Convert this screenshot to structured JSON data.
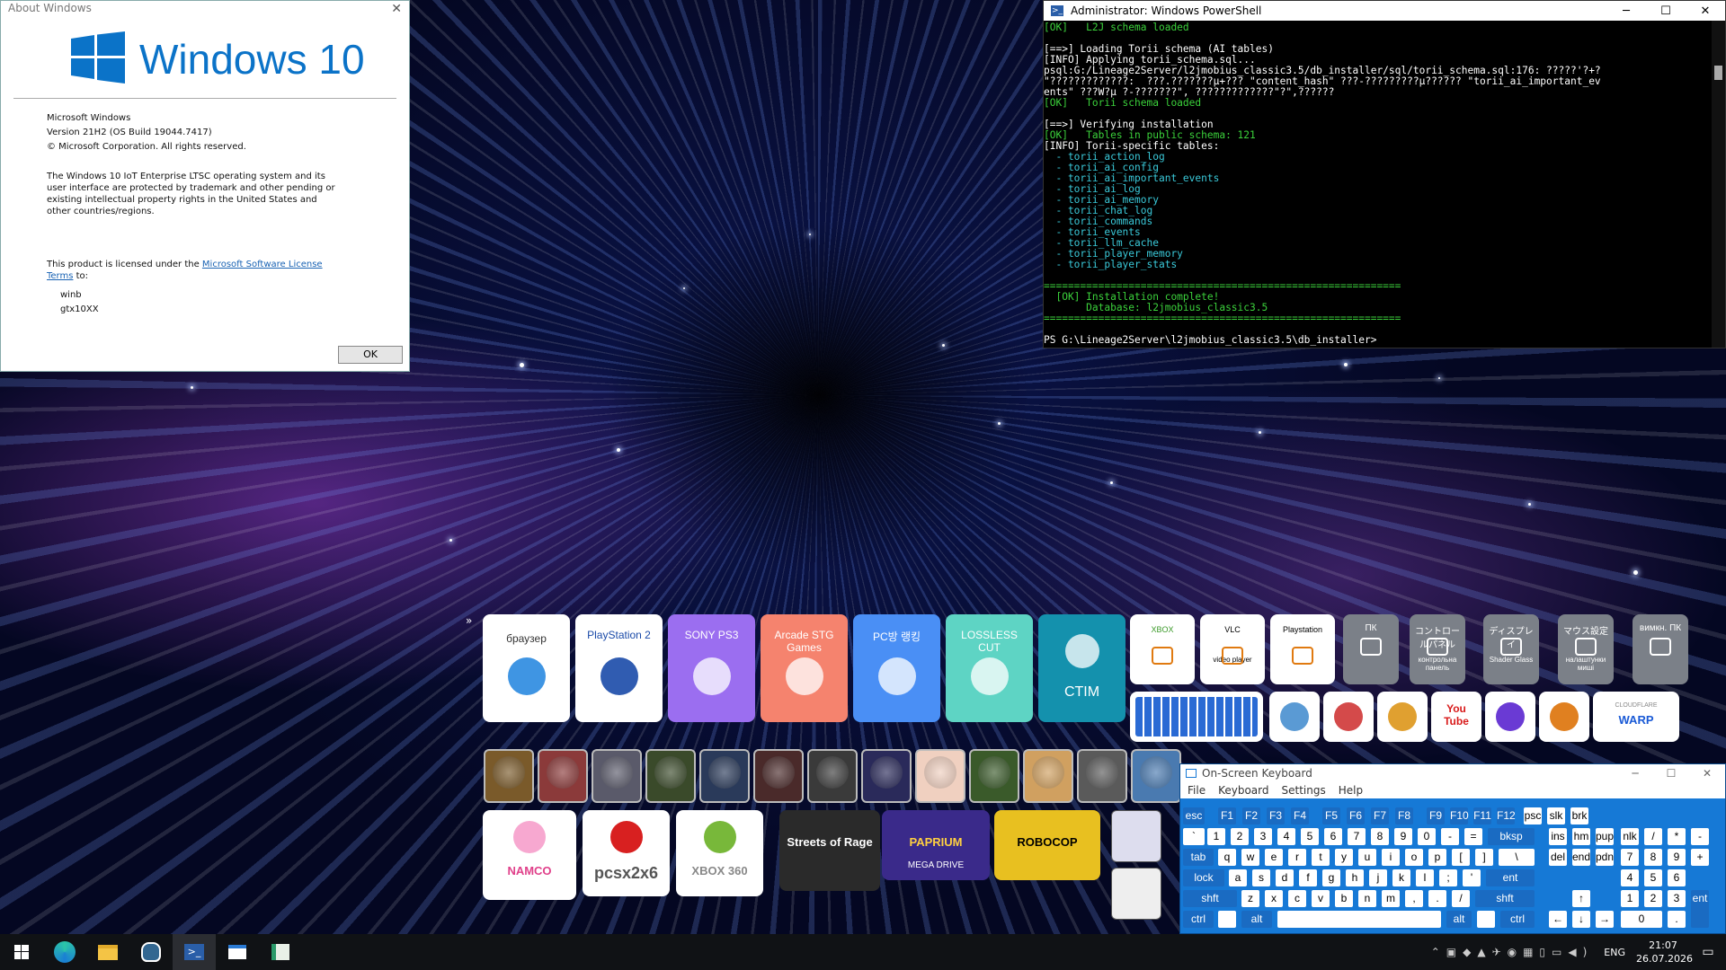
{
  "about": {
    "title": "About Windows",
    "logo_text": "Windows 10",
    "product": "Microsoft Windows",
    "version": "Version 21H2 (OS Build 19044.7417)",
    "copyright": "© Microsoft Corporation. All rights reserved.",
    "description": "The Windows 10 IoT Enterprise LTSC operating system and its user interface are protected by trademark and other pending or existing intellectual property rights in the United States and other countries/regions.",
    "license_prefix": "This product is licensed under the",
    "license_link": "Microsoft Software License Terms",
    "license_suffix": "to:",
    "user": "winb",
    "org": "gtx10XX",
    "ok_label": "OK"
  },
  "powershell": {
    "title": "Administrator: Windows PowerShell",
    "lines": [
      {
        "t": "[OK]   L2J schema loaded",
        "c": "g"
      },
      {
        "t": "",
        "c": "w"
      },
      {
        "t": "[==>] Loading Torii schema (AI tables)",
        "c": "w"
      },
      {
        "t": "[INFO] Applying torii_schema.sql...",
        "c": "w"
      },
      {
        "t": "psql:G:/Lineage2Server/l2jmobius_classic3.5/db_installer/sql/torii_schema.sql:176: ?????'?+?",
        "c": "w"
      },
      {
        "t": "\"?????????????:  ???.???????µ+??? \"content_hash\" ???-?????????µ?????? \"torii_ai_important_ev",
        "c": "w"
      },
      {
        "t": "ents\" ???W?µ ?-???????\", ?????????????\"?\",??????",
        "c": "w"
      },
      {
        "t": "[OK]   Torii schema loaded",
        "c": "g"
      },
      {
        "t": "",
        "c": "w"
      },
      {
        "t": "[==>] Verifying installation",
        "c": "w"
      },
      {
        "t": "[OK]   Tables in public schema: 121",
        "c": "g"
      },
      {
        "t": "[INFO] Torii-specific tables:",
        "c": "w"
      },
      {
        "t": "  - torii_action_log",
        "c": "c"
      },
      {
        "t": "  - torii_ai_config",
        "c": "c"
      },
      {
        "t": "  - torii_ai_important_events",
        "c": "c"
      },
      {
        "t": "  - torii_ai_log",
        "c": "c"
      },
      {
        "t": "  - torii_ai_memory",
        "c": "c"
      },
      {
        "t": "  - torii_chat_log",
        "c": "c"
      },
      {
        "t": "  - torii_commands",
        "c": "c"
      },
      {
        "t": "  - torii_events",
        "c": "c"
      },
      {
        "t": "  - torii_llm_cache",
        "c": "c"
      },
      {
        "t": "  - torii_player_memory",
        "c": "c"
      },
      {
        "t": "  - torii_player_stats",
        "c": "c"
      },
      {
        "t": "",
        "c": "w"
      },
      {
        "t": "===========================================================",
        "c": "g"
      },
      {
        "t": "  [OK] Installation complete!",
        "c": "g"
      },
      {
        "t": "       Database: l2jmobius_classic3.5",
        "c": "g"
      },
      {
        "t": "===========================================================",
        "c": "g"
      },
      {
        "t": "",
        "c": "w"
      },
      {
        "t": "PS G:\\Lineage2Server\\l2jmobius_classic3.5\\db_installer>",
        "c": "w"
      }
    ]
  },
  "tiles_large": [
    {
      "id": "browser",
      "label": "браузер",
      "bg": "#ffffff",
      "fg": "#333"
    },
    {
      "id": "ps2",
      "label": "PlayStation 2",
      "bg": "#ffffff",
      "fg": "#1a4aa8"
    },
    {
      "id": "ps3",
      "label": "SONY PS3",
      "bg": "#9b6ef0",
      "fg": "#fff"
    },
    {
      "id": "mame",
      "label": "Arcade STG Games",
      "bg": "#f5836e",
      "fg": "#fff"
    },
    {
      "id": "opgg",
      "label": "PC방 랭킹",
      "bg": "#4a8ff5",
      "fg": "#fff"
    },
    {
      "id": "lossless",
      "label": "LOSSLESS CUT",
      "bg": "#5ed4c4",
      "fg": "#fff"
    },
    {
      "id": "steam",
      "label": "CTIM",
      "bg": "#1491ad",
      "fg": "#fff"
    }
  ],
  "tiles_small_top": [
    {
      "id": "xbox",
      "label": "XBOX",
      "bg": "#ffffff",
      "fg": "#3c9a2a"
    },
    {
      "id": "vlc",
      "label": "VLC",
      "sub": "video player",
      "bg": "#ffffff",
      "fg": "#000"
    },
    {
      "id": "playstation",
      "label": "Playstation",
      "bg": "#ffffff",
      "fg": "#000"
    },
    {
      "id": "pc",
      "label": "ПК",
      "bg": "#7b8088",
      "fg": "#fff"
    },
    {
      "id": "control",
      "label": "コントロールパネル",
      "sub": "контрольна панель",
      "bg": "#7b8088",
      "fg": "#fff"
    },
    {
      "id": "display",
      "label": "ディスプレイ",
      "sub": "Shader Glass",
      "bg": "#7b8088",
      "fg": "#fff"
    },
    {
      "id": "mouse",
      "label": "マウス設定",
      "sub": "налаштунки миші",
      "bg": "#7b8088",
      "fg": "#fff"
    },
    {
      "id": "power",
      "label": "вимкн. ПК",
      "bg": "#7b8088",
      "fg": "#fff"
    }
  ],
  "tiles_row2": [
    {
      "id": "osk",
      "bg": "#ffffff"
    },
    {
      "id": "emu",
      "bg": "#ffffff"
    },
    {
      "id": "orbit",
      "bg": "#ffffff"
    },
    {
      "id": "cocktail",
      "bg": "#ffffff"
    },
    {
      "id": "youtube",
      "label": "You Tube",
      "bg": "#ffffff"
    },
    {
      "id": "tor",
      "bg": "#ffffff"
    },
    {
      "id": "bolt",
      "bg": "#ffffff"
    },
    {
      "id": "warp",
      "label": "WARP",
      "sub": "CLOUDFLARE",
      "bg": "#ffffff"
    }
  ],
  "game_row_colors": [
    "#7a5a2a",
    "#8b3a3a",
    "#5a5a6a",
    "#3a4a2a",
    "#2a3a5a",
    "#4a2a2a",
    "#3a3a3a",
    "#2a2a5a",
    "#f0d0c0",
    "#3a5a2a",
    "#d0a060",
    "#5a5a5a",
    "#4a7ab0"
  ],
  "tiles_bottom": [
    {
      "id": "namco",
      "label": "NAMCO",
      "bg": "#ffffff",
      "fg": "#e0408a"
    },
    {
      "id": "pcsx2",
      "label": "pcsx2x6",
      "bg": "#ffffff",
      "fg": "#555"
    },
    {
      "id": "xbox360",
      "label": "XBOX 360",
      "bg": "#ffffff",
      "fg": "#888"
    },
    {
      "id": "streets",
      "label": "Streets of Rage",
      "bg": "#2a2a2a",
      "fg": "#fff"
    },
    {
      "id": "paprium",
      "label": "PAPRIUM",
      "sub": "MEGA DRIVE",
      "bg": "#3a2a8a",
      "fg": "#ffd040"
    },
    {
      "id": "robocop",
      "label": "ROBOCOP",
      "bg": "#e8c020",
      "fg": "#000"
    }
  ],
  "osk": {
    "title": "On-Screen Keyboard",
    "menu": [
      "File",
      "Keyboard",
      "Settings",
      "Help"
    ]
  },
  "taskbar": {
    "lang": "ENG",
    "time": "21:07",
    "date": "26.07.2026"
  },
  "colors": {
    "accent": "#0b73c8",
    "osk": "#1679d6",
    "taskbar": "#101215"
  }
}
